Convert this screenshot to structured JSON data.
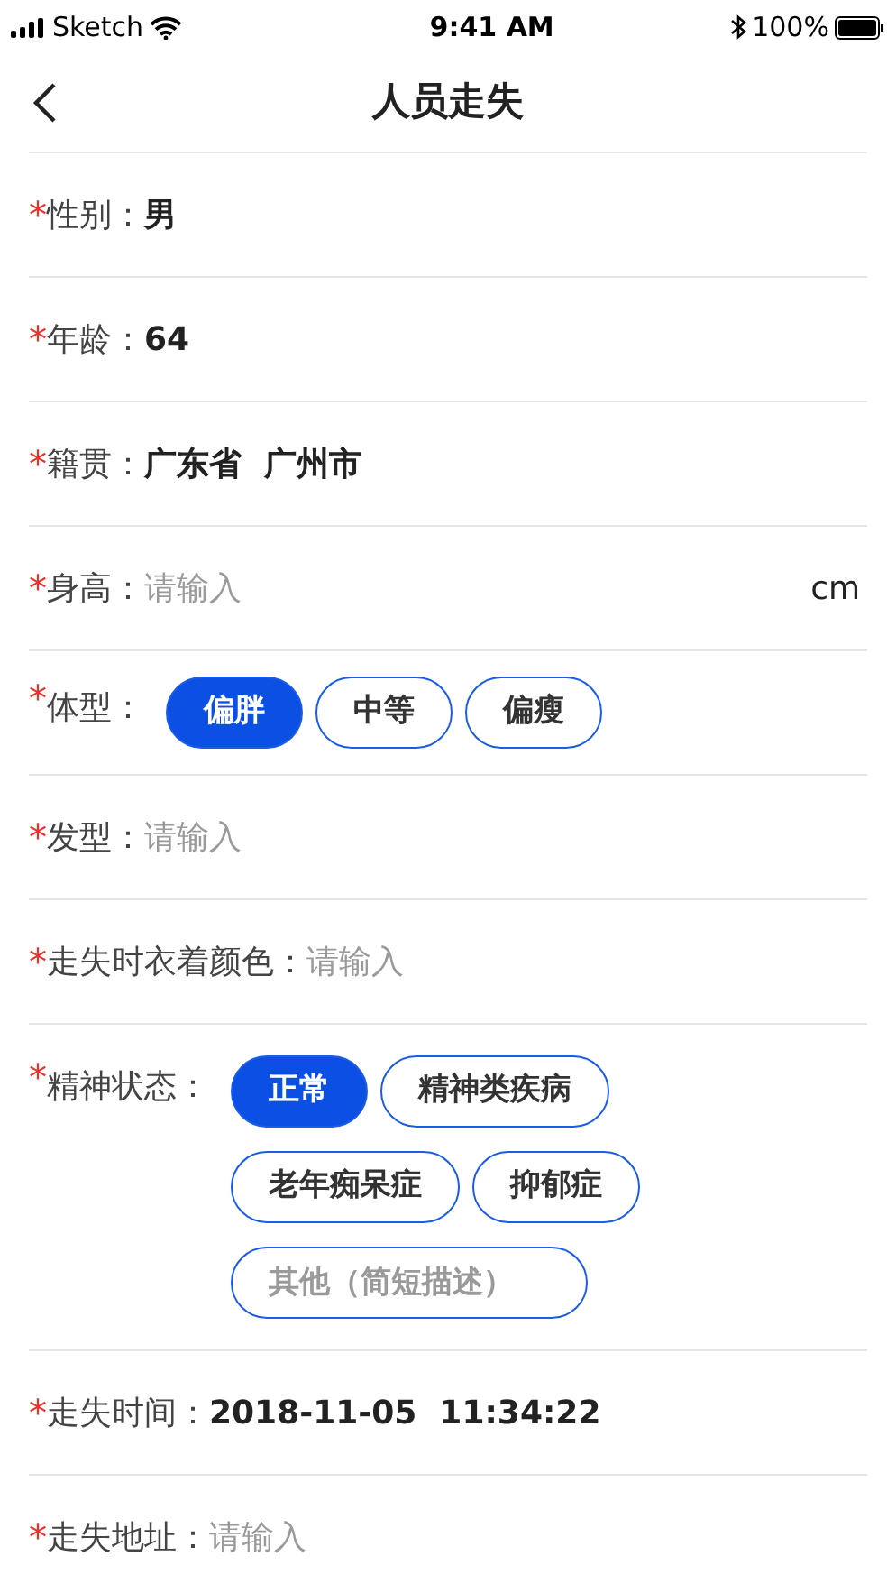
{
  "status_bar": {
    "carrier": "Sketch",
    "time": "9:41 AM",
    "battery": "100%"
  },
  "nav": {
    "title": "人员走失"
  },
  "rows": [
    {
      "kind": "value",
      "marker": "*",
      "label": "性别：",
      "value": "男"
    },
    {
      "kind": "value",
      "marker": "*",
      "label": "年龄：",
      "value": "64"
    },
    {
      "kind": "value",
      "marker": "*",
      "label": "籍贯：",
      "value": "广东省  广州市"
    },
    {
      "kind": "input",
      "marker": "*",
      "label": "身高：",
      "placeholder": "请输入",
      "unit": "cm"
    },
    {
      "kind": "chips",
      "marker": "*",
      "label": "体型：",
      "options": [
        {
          "kind": "chip",
          "label": "偏胖",
          "selected": true
        },
        {
          "kind": "chip",
          "label": "中等",
          "selected": false
        },
        {
          "kind": "chip",
          "label": "偏瘦",
          "selected": false
        }
      ]
    },
    {
      "kind": "input",
      "marker": "*",
      "label": "发型：",
      "placeholder": "请输入"
    },
    {
      "kind": "input",
      "marker": "*",
      "label": "走失时衣着颜色：",
      "placeholder": "请输入"
    },
    {
      "kind": "chips",
      "marker": "*",
      "label": "精神状态：",
      "options": [
        {
          "kind": "chip",
          "label": "正常",
          "selected": true
        },
        {
          "kind": "chip",
          "label": "精神类疾病",
          "selected": false
        },
        {
          "kind": "chip",
          "label": "老年痴呆症",
          "selected": false
        },
        {
          "kind": "chip",
          "label": "抑郁症",
          "selected": false
        },
        {
          "kind": "input",
          "placeholder": "其他（简短描述）"
        }
      ]
    },
    {
      "kind": "value",
      "marker": "*",
      "label": "走失时间：",
      "value": "2018-11-05  11:34:22"
    },
    {
      "kind": "input",
      "marker": "*",
      "label": "走失地址：",
      "placeholder": "请输入"
    }
  ]
}
